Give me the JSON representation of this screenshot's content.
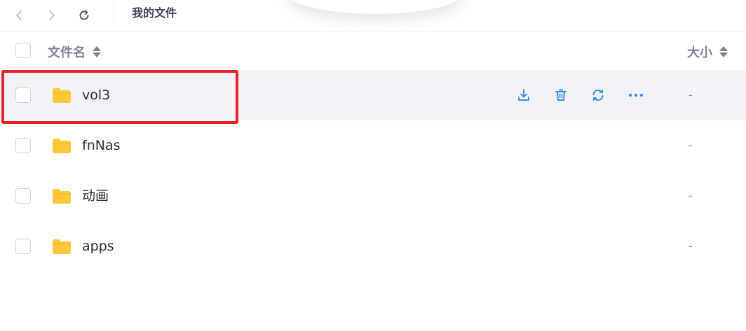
{
  "toolbar": {
    "back_icon": "chevron-left-icon",
    "forward_icon": "chevron-right-icon",
    "refresh_icon": "refresh-icon",
    "path_title": "我的文件"
  },
  "table": {
    "col_name": "文件名",
    "col_size": "大小",
    "rows": [
      {
        "name": "vol3",
        "size": "-",
        "hovered": true
      },
      {
        "name": "fnNas",
        "size": "-"
      },
      {
        "name": "动画",
        "size": "-"
      },
      {
        "name": "apps",
        "size": "-"
      }
    ],
    "row_actions": [
      "download-icon",
      "trash-icon",
      "sync-icon",
      "more-icon"
    ]
  },
  "colors": {
    "folder": "#fdc83a",
    "action": "#3b8cf0",
    "highlight": "#e8202a",
    "hover_row": "#f2f3f6"
  }
}
